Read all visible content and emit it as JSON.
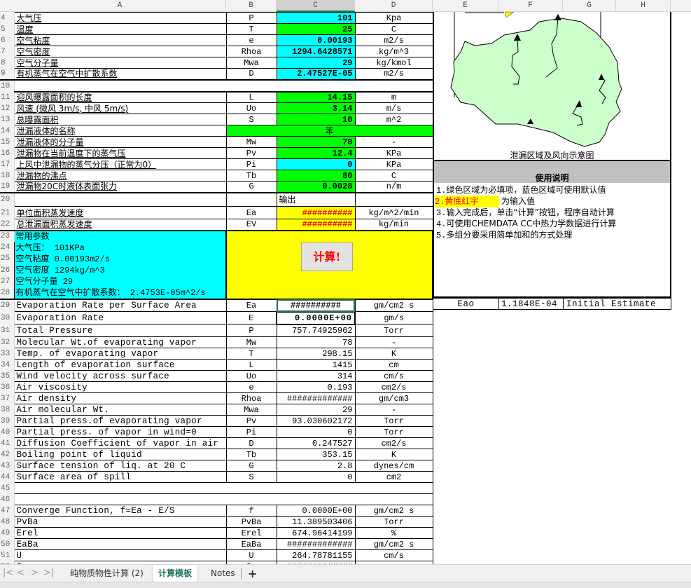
{
  "column_headers": [
    "A",
    "B",
    "C",
    "D",
    "E",
    "F",
    "G",
    "H"
  ],
  "selected_column": "C",
  "rows": [
    {
      "num": "4",
      "a": "大气压",
      "b": "P",
      "c": "101",
      "d": "Kpa",
      "fill": "cyan"
    },
    {
      "num": "5",
      "a": "温度",
      "b": "T",
      "c": "25",
      "d": "C",
      "fill": "green"
    },
    {
      "num": "6",
      "a": "空气粘度",
      "b": "e",
      "c": "0.00193",
      "d": "m2/s",
      "fill": "cyan"
    },
    {
      "num": "7",
      "a": "空气密度",
      "b": "Rhoa",
      "c": "1294.6428571",
      "d": "kg/m^3",
      "fill": "cyan"
    },
    {
      "num": "8",
      "a": "空气分子量",
      "b": "Mwa",
      "c": "29",
      "d": "kg/kmol",
      "fill": "cyan"
    },
    {
      "num": "9",
      "a": "有机蒸气在空气中扩散系数",
      "b": "D",
      "c": "2.47527E-05",
      "d": "m2/s",
      "fill": "cyan"
    },
    {
      "num": "10"
    },
    {
      "num": "11",
      "a": "迎风曝露面积的长度",
      "b": "L",
      "c": "14.15",
      "d": "m",
      "fill": "green"
    },
    {
      "num": "12",
      "a": "风速 (微风 3m/s, 中风 5m/s)",
      "b": "Uo",
      "c": "3.14",
      "d": "m/s",
      "fill": "green"
    },
    {
      "num": "13",
      "a": "总曝露面积",
      "b": "S",
      "c": "10",
      "d": "m^2",
      "fill": "green"
    },
    {
      "num": "14",
      "a": "泄漏液体的名称",
      "merged": "苯",
      "fill": "green"
    },
    {
      "num": "15",
      "a": "泄漏液体的分子量",
      "b": "Mw",
      "c": "78",
      "d": "-",
      "fill": "green"
    },
    {
      "num": "16",
      "a": "泄漏物在当前温度下的蒸气压",
      "b": "Pv",
      "c": "12.4",
      "d": "KPa",
      "fill": "green"
    },
    {
      "num": "17",
      "a": "上风中泄漏物的蒸气分压（正常为0）",
      "b": "Pi",
      "c": "0",
      "d": "KPa",
      "fill": "cyan"
    },
    {
      "num": "18",
      "a": "泄漏物的沸点",
      "b": "Tb",
      "c": "80",
      "d": "C",
      "fill": "green"
    },
    {
      "num": "19",
      "a": "泄漏物20C时液体表面张力",
      "b": "G",
      "c": "0.0028",
      "d": "n/m",
      "fill": "green"
    },
    {
      "num": "20",
      "a": "",
      "b": "",
      "c": "输出",
      "d": ""
    },
    {
      "num": "21",
      "a": "单位面积蒸发速度",
      "b": "Ea",
      "c": "##########",
      "d": "kg/m^2/min",
      "fill": "yellow"
    },
    {
      "num": "22",
      "a": "总泄漏面积蒸发速度",
      "b": "EV",
      "c": "##########",
      "d": "kg/min",
      "fill": "yellow"
    }
  ],
  "params_block": {
    "row_nums": [
      "23",
      "24",
      "25",
      "26",
      "27",
      "28"
    ],
    "lines": [
      "常用参数",
      "大气压： 101KPa",
      "空气粘度 0.00193m2/s",
      "空气密度 1294kg/m^3",
      "空气分子量 29",
      "有机蒸气在空气中扩散系数： 2.4753E-05m^2/s"
    ]
  },
  "calc_button": "计算!",
  "english_rows": [
    {
      "num": "29",
      "a": "Evaporation Rate per Surface Area",
      "b": "Ea",
      "c": "##########",
      "d": "gm/cm2 s"
    },
    {
      "num": "30",
      "a": "Evaporation Rate",
      "b": "E",
      "c": "0.0000E+00",
      "d": "gm/s"
    },
    {
      "num": "31",
      "a": "Total Pressure",
      "b": "P",
      "c": "757.74925962",
      "d": "Torr"
    },
    {
      "num": "32",
      "a": "Molecular Wt.of evaporating vapor",
      "b": "Mw",
      "c": "78",
      "d": "-"
    },
    {
      "num": "33",
      "a": "Temp. of evaporating vapor",
      "b": "T",
      "c": "298.15",
      "d": "K"
    },
    {
      "num": "34",
      "a": "Length of evaporation surface",
      "b": "L",
      "c": "1415",
      "d": "cm"
    },
    {
      "num": "35",
      "a": "Wind velocity across surface",
      "b": "Uo",
      "c": "314",
      "d": "cm/s"
    },
    {
      "num": "36",
      "a": "Air viscosity",
      "b": "e",
      "c": "0.193",
      "d": "cm2/s"
    },
    {
      "num": "37",
      "a": "Air density",
      "b": "Rhoa",
      "c": "#############",
      "d": "gm/cm3"
    },
    {
      "num": "38",
      "a": "Air molecular Wt.",
      "b": "Mwa",
      "c": "29",
      "d": "-"
    },
    {
      "num": "39",
      "a": "Partial press.of evaporating vapor",
      "b": "Pv",
      "c": "93.030602172",
      "d": "Torr"
    },
    {
      "num": "40",
      "a": "Partial press. of vapor in wind=0",
      "b": "Pi",
      "c": "0",
      "d": "Torr"
    },
    {
      "num": "41",
      "a": "Diffusion Coefficient of vapor in air",
      "b": "D",
      "c": "0.247527",
      "d": "cm2/s"
    },
    {
      "num": "42",
      "a": "Boiling point of liquid",
      "b": "Tb",
      "c": "353.15",
      "d": "K"
    },
    {
      "num": "43",
      "a": "Surface tension of liq. at 20 C",
      "b": "G",
      "c": "2.8",
      "d": "dynes/cm"
    },
    {
      "num": "44",
      "a": "Surface area of spill",
      "b": "S",
      "c": "0",
      "d": "cm2"
    },
    {
      "num": "45",
      "blank": true
    },
    {
      "num": "46",
      "blank": true
    },
    {
      "num": "47",
      "a": "Converge Function, f=Ea - E/S",
      "b": "f",
      "c": "0.0000E+00",
      "d": "gm/cm2 s"
    },
    {
      "num": "48",
      "a": "PvBa",
      "b": "PvBa",
      "c": "11.389503406",
      "d": "Torr"
    },
    {
      "num": "49",
      "a": "Erel",
      "b": "Erel",
      "c": "674.96414199",
      "d": "%"
    },
    {
      "num": "50",
      "a": "EaBa",
      "b": "EaBa",
      "c": "#############",
      "d": "gm/cm2 s"
    },
    {
      "num": "51",
      "a": "U",
      "b": "U",
      "c": "264.78781155",
      "d": "cm/s"
    },
    {
      "num": "52",
      "a": "Sc",
      "b": "Sc",
      "c": "#############",
      "d": ""
    }
  ],
  "diagram": {
    "caption": "泄漏区域及风向示意图",
    "fill_color": "#ccffcc"
  },
  "instructions": {
    "title": "使用说明",
    "items": [
      {
        "num": "1.",
        "text": "绿色区域为必填项，蓝色区域可使用默认值"
      },
      {
        "num": "2.",
        "highlight": "黄底红字",
        "text": "为输入值"
      },
      {
        "num": "3.",
        "text": "输入完成后，单击“计算”按钮，程序自动计算"
      },
      {
        "num": "4.",
        "text": "可使用CHEMDATA CC中热力学数据进行计算"
      },
      {
        "num": "5.",
        "text": "多组分要采用简单加和的方式处理"
      }
    ]
  },
  "estimate_row": {
    "label": "Eao",
    "value": "1.1848E-04",
    "note": "Initial Estimate"
  },
  "sheet_tabs": [
    {
      "label": "纯物质物性计算 (2)",
      "active": false
    },
    {
      "label": "计算模板",
      "active": true
    },
    {
      "label": "Notes",
      "active": false
    }
  ],
  "add_sheet": "+",
  "nav_icons": [
    "first-sheet-icon",
    "prev-sheet-icon",
    "next-sheet-icon",
    "last-sheet-icon"
  ]
}
